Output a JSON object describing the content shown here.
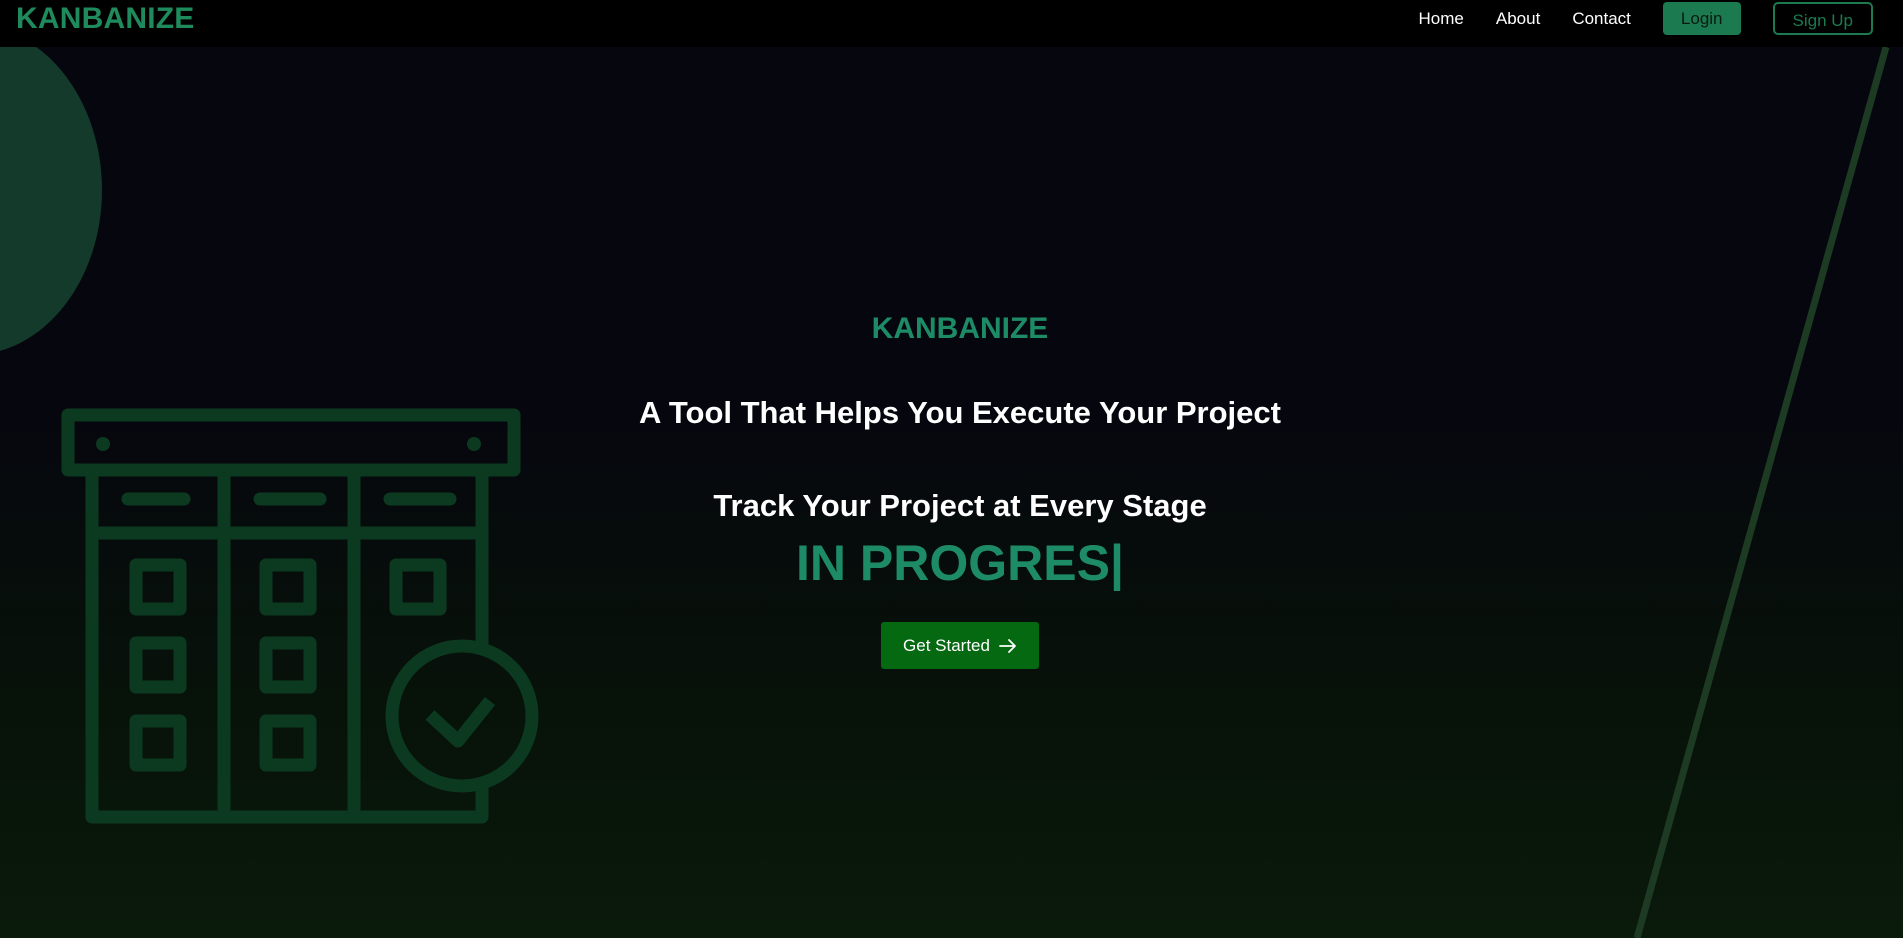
{
  "navbar": {
    "brand": "KANBANIZE",
    "links": [
      "Home",
      "About",
      "Contact"
    ],
    "login_label": "Login",
    "signup_label": "Sign Up"
  },
  "hero": {
    "brand": "KANBANIZE",
    "title": "A Tool That Helps You Execute Your Project",
    "subtitle": "Track Your Project at Every Stage",
    "typing_text": "IN PROGRES",
    "cursor": "|",
    "cta_label": "Get Started",
    "cta_icon": "arrow-right-icon"
  },
  "colors": {
    "accent": "#1d8c66",
    "cta": "#056912",
    "background": "#06060e"
  }
}
